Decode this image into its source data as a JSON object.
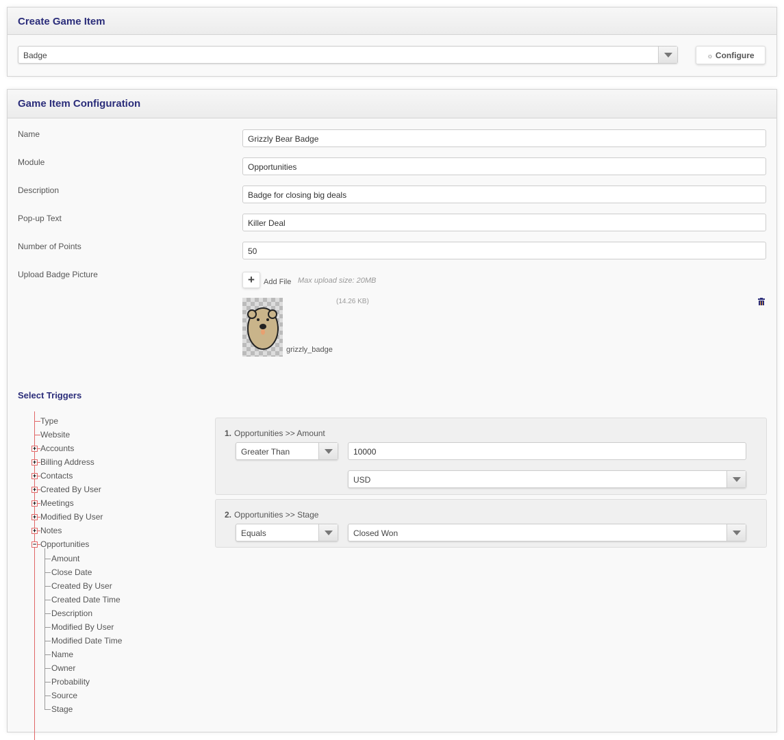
{
  "create_panel": {
    "title": "Create Game Item",
    "item_type": "Badge",
    "configure_label": "Configure",
    "configure_icon": "gear-icon"
  },
  "config_panel": {
    "title": "Game Item Configuration",
    "fields": [
      {
        "label": "Name",
        "value": "Grizzly Bear Badge"
      },
      {
        "label": "Module",
        "value": "Opportunities"
      },
      {
        "label": "Description",
        "value": "Badge for closing big deals"
      },
      {
        "label": "Pop-up Text",
        "value": "Killer Deal"
      },
      {
        "label": "Number of Points",
        "value": "50"
      }
    ],
    "upload": {
      "label": "Upload Badge Picture",
      "add_file": "Add File",
      "max_size": "Max upload size: 20MB",
      "file_name": "grizzly_badge",
      "file_size": "(14.26 KB)"
    },
    "triggers_title": "Select Triggers",
    "tree": {
      "top": [
        {
          "label": "Type",
          "type": "leaf"
        },
        {
          "label": "Website",
          "type": "leaf"
        },
        {
          "label": "Accounts",
          "type": "plus"
        },
        {
          "label": "Billing Address",
          "type": "plus"
        },
        {
          "label": "Contacts",
          "type": "plus"
        },
        {
          "label": "Created By User",
          "type": "plus"
        },
        {
          "label": "Meetings",
          "type": "plus"
        },
        {
          "label": "Modified By User",
          "type": "plus"
        },
        {
          "label": "Notes",
          "type": "plus"
        },
        {
          "label": "Opportunities",
          "type": "minus"
        }
      ],
      "children": [
        "Amount",
        "Close Date",
        "Created By User",
        "Created Date Time",
        "Description",
        "Modified By User",
        "Modified Date Time",
        "Name",
        "Owner",
        "Probability",
        "Source",
        "Stage"
      ]
    },
    "triggers": [
      {
        "number": "1.",
        "path": "Opportunities >> Amount",
        "operator": "Greater Than",
        "value": "10000",
        "currency": "USD"
      },
      {
        "number": "2.",
        "path": "Opportunities >> Stage",
        "operator": "Equals",
        "value": "Closed Won"
      }
    ]
  }
}
